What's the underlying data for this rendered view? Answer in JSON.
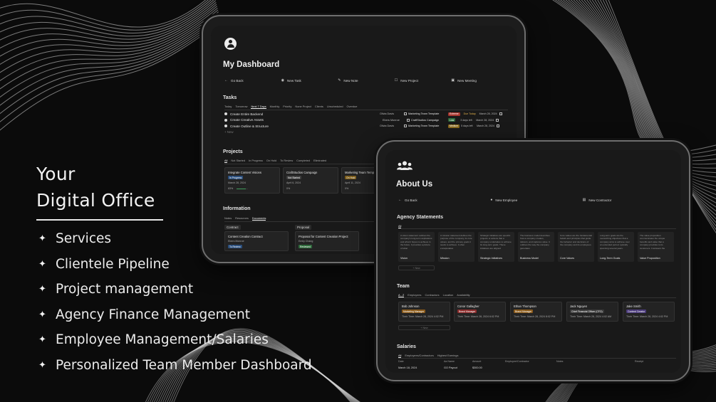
{
  "hero": {
    "title_line1": "Your",
    "title_line2": "Digital Office",
    "features": [
      "Services",
      "Clientele Pipeline",
      "Project management",
      "Agency Finance Management",
      "Employee Management/Salaries",
      "Personalized Team Member Dashboard"
    ]
  },
  "dashboard": {
    "title": "My Dashboard",
    "actions": [
      "Go Back",
      "New Task",
      "New Note",
      "New Project",
      "New Meeting"
    ],
    "tasks": {
      "heading": "Tasks",
      "tabs": [
        "Today",
        "Tomorrow",
        "Next 7 Days",
        "Monthly",
        "Priority",
        "None Project",
        "Clients",
        "Unscheduled",
        "Overdue"
      ],
      "active_tab": "Next 7 Days",
      "rows": [
        {
          "name": "Create Entire Backend",
          "assignee": "Olivia Davis",
          "project": "Marketing Team Template",
          "priority": "Extreme",
          "priority_color": "#a8362f",
          "due": "Due Today",
          "date": "March 28, 2024"
        },
        {
          "name": "Create Creative Assets",
          "assignee": "Ebers Monroe",
          "project": "CraftStudios Campaign",
          "priority": "Low",
          "priority_color": "#2f6b3c",
          "due": "3 days left",
          "date": "March 28, 2024"
        },
        {
          "name": "Create Outline & Structure",
          "assignee": "Olivia Davis",
          "project": "Marketing Team Template",
          "priority": "Medium",
          "priority_color": "#8a6a1f",
          "due": "5 days left",
          "date": "March 28, 2024"
        }
      ],
      "new_label": "+ New"
    },
    "projects": {
      "heading": "Projects",
      "tabs": [
        "All",
        "Not Started",
        "In Progress",
        "On Hold",
        "To Review",
        "Completed",
        "Eliminated"
      ],
      "cards": [
        {
          "title": "Integrate Content Visions",
          "status": "In Progress",
          "status_color": "#2b4f7d",
          "date": "March 28, 2024",
          "progress": "83%"
        },
        {
          "title": "CraftStudios Campaign",
          "status": "Not Started",
          "status_color": "#3d3d3d",
          "date": "April 6, 2024",
          "progress": "0%"
        },
        {
          "title": "Marketing Team Temp",
          "status": "On Hold",
          "status_color": "#7a5a17",
          "date": "April 11, 2024",
          "progress": "0%"
        }
      ]
    },
    "information": {
      "heading": "Information",
      "tabs": [
        "Notes",
        "Resources",
        "Documents"
      ],
      "groups": [
        {
          "label": "Contract",
          "card_title": "Content Creation Contract",
          "person": "Ebers Monroe",
          "status": "To Review",
          "status_color": "#2b4f7d"
        },
        {
          "label": "Proposal",
          "card_title": "Proposal for Content Creation Project",
          "person": "Emily Chang",
          "status": "Reviewed",
          "status_color": "#2f6b3c"
        }
      ]
    }
  },
  "about": {
    "title": "About Us",
    "actions": [
      "Go Back",
      "New Employee",
      "New Contractor"
    ],
    "statements": {
      "heading": "Agency Statements",
      "tab": "All",
      "cards": [
        {
          "text": "A vision statement outlines the company's long-term aspirations and what it hopes to achieve in the future. It provides a picture of what",
          "name": "Vision"
        },
        {
          "text": "A mission statement defines the purpose of the company, its core values, and the primary goals it seeks to achieve. It often encapsulates",
          "name": "Mission"
        },
        {
          "text": "Strategic initiatives are specific projects or actions that a company undertakes to achieve its long-term goals. These initiatives are aligned",
          "name": "Strategic Initiatives"
        },
        {
          "text": "The business model describes how a company creates, delivers, and captures value. It outlines the way the company generates",
          "name": "Business Model"
        },
        {
          "text": "Core values are the fundamental beliefs and principles that guide the behavior and decisions of the company and its employees.",
          "name": "Core Values"
        },
        {
          "text": "Long-term goals are the overarching objectives that a company aims to achieve over an extended period, typically spanning several years.",
          "name": "Long-Term Goals"
        },
        {
          "text": "The value proposition communicates the unique benefits and value that a company provides to its customers. It answers the",
          "name": "Value Proposition"
        }
      ],
      "new_label": "+ New"
    },
    "team": {
      "heading": "Team",
      "tabs": [
        "A - Z",
        "Employees",
        "Contractors",
        "Location",
        "Availability"
      ],
      "members": [
        {
          "name": "Bob Johnson",
          "role": "Marketing Manager",
          "role_color": "#8a5a1a",
          "time": "Their Time: March 28, 2024 4:02 PM"
        },
        {
          "name": "Conor Gallagher",
          "role": "Brand Manager",
          "role_color": "#8a2a2a",
          "time": "Their Time: March 28, 2024 6:02 PM"
        },
        {
          "name": "Ethan Thompson",
          "role": "Brand Manager",
          "role_color": "#8a5a1a",
          "time": "Their Time: March 28, 2024 8:02 PM"
        },
        {
          "name": "Jack Nguyen",
          "role": "Chief Financial Officer (CFO)",
          "role_color": "#3a3a3a",
          "time": "Their Time: March 28, 2024 4:02 AM"
        },
        {
          "name": "Jake Smith",
          "role": "Content Creator",
          "role_color": "#4a3a7a",
          "time": "Their Time: March 28, 2024 4:02 PM"
        }
      ],
      "new_label": "+ New"
    },
    "salaries": {
      "heading": "Salaries",
      "tabs": [
        "All",
        "Employees/Contractors",
        "Highest Earnings"
      ],
      "columns": [
        "Date",
        "Aa Name",
        "Amount",
        "Employee/Contractor",
        "Notes",
        "Receipt"
      ],
      "row": {
        "date": "March 18, 2024",
        "name": "GO Payout",
        "amount": "$300.00"
      }
    }
  }
}
